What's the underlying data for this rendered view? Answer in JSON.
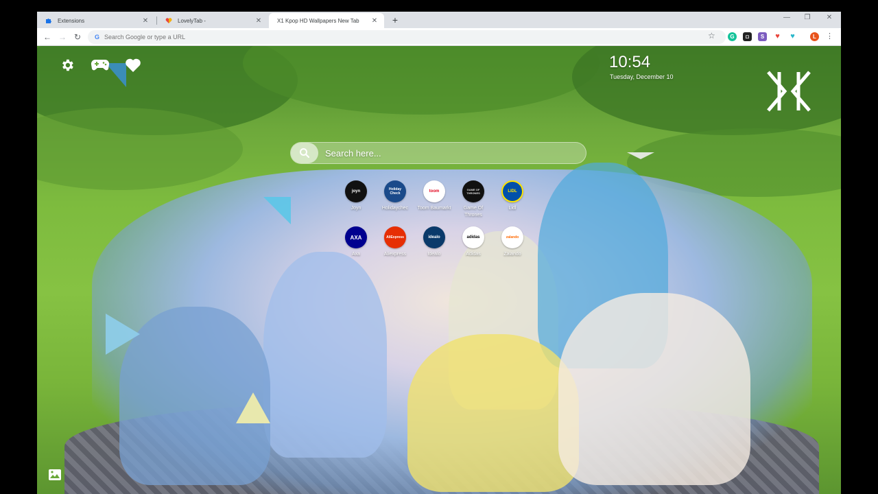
{
  "browser": {
    "tabs": [
      {
        "title": "Extensions",
        "icon": "puzzle-icon",
        "active": false
      },
      {
        "title": "LovelyTab -",
        "icon": "heart-icon",
        "active": false
      },
      {
        "title": "X1 Kpop HD Wallpapers New Tab",
        "icon": "",
        "active": true
      }
    ],
    "new_tab_label": "+",
    "close_label": "✕",
    "omnibox_placeholder": "Search Google or type a URL",
    "profile_initial": "L"
  },
  "page": {
    "time": "10:54",
    "date": "Tuesday, December 10",
    "search_placeholder": "Search here...",
    "top_icons": [
      "gear-icon",
      "gamepad-icon",
      "heart-icon"
    ],
    "shortcuts": [
      {
        "label": "Joyn",
        "logo_text": "joyn",
        "bg": "#111111",
        "fg": "#ffffff"
      },
      {
        "label": "Holidaychec",
        "logo_text": "Holiday Check",
        "bg": "#1a4a8a",
        "fg": "#ffffff"
      },
      {
        "label": "Toom Baumarkt",
        "logo_text": "toom",
        "bg": "#ffffff",
        "fg": "#e2001a"
      },
      {
        "label": "Game Of Thrones",
        "logo_text": "GAME OF THRONES",
        "bg": "#111111",
        "fg": "#dddddd"
      },
      {
        "label": "Lidl",
        "logo_text": "LIDL",
        "bg": "#0050aa",
        "fg": "#ffe500"
      },
      {
        "label": "Axa",
        "logo_text": "AXA",
        "bg": "#00008f",
        "fg": "#ffffff"
      },
      {
        "label": "Aliexpress",
        "logo_text": "AliExpress",
        "bg": "#e62e04",
        "fg": "#ffffff"
      },
      {
        "label": "Idealo",
        "logo_text": "idealo",
        "bg": "#0a3a6a",
        "fg": "#ffffff"
      },
      {
        "label": "Adidas",
        "logo_text": "adidas",
        "bg": "#ffffff",
        "fg": "#000000"
      },
      {
        "label": "Zalando",
        "logo_text": "zalando",
        "bg": "#ffffff",
        "fg": "#ff6900"
      }
    ]
  }
}
